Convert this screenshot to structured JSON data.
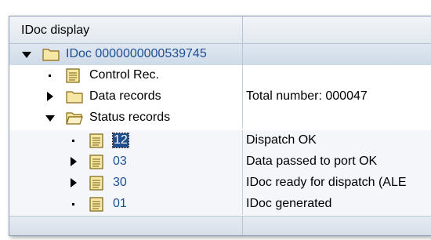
{
  "header": {
    "col1_title": "IDoc display"
  },
  "tree": {
    "root": {
      "label": "IDoc 0000000000539745"
    },
    "control": {
      "label": "Control Rec."
    },
    "data_records": {
      "label": "Data records",
      "detail": "Total number: 000047"
    },
    "status_records": {
      "label": "Status records"
    },
    "statuses": [
      {
        "code": "12",
        "description": "Dispatch OK",
        "selected": true
      },
      {
        "code": "03",
        "description": "Data passed to port OK"
      },
      {
        "code": "30",
        "description": "IDoc ready for dispatch (ALE"
      },
      {
        "code": "01",
        "description": "IDoc generated"
      }
    ]
  },
  "icons": {
    "folder": "folder-icon",
    "folder_open": "folder-open-icon",
    "document": "document-icon"
  }
}
